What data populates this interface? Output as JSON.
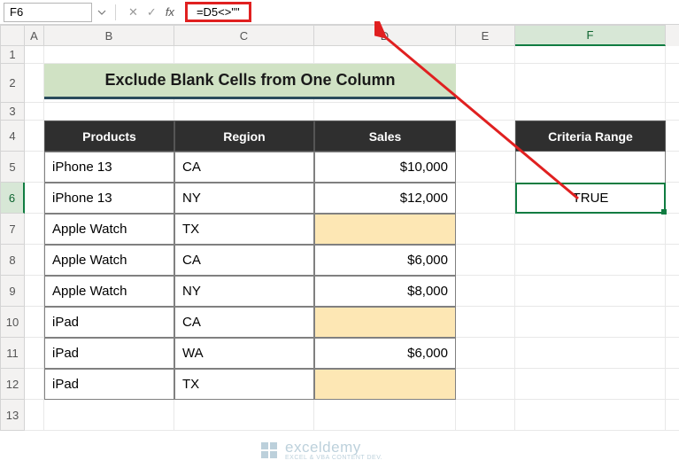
{
  "formula_bar": {
    "name_box": "F6",
    "formula": "=D5<>\"\""
  },
  "columns": [
    "A",
    "B",
    "C",
    "D",
    "E",
    "F"
  ],
  "rows": [
    "1",
    "2",
    "3",
    "4",
    "5",
    "6",
    "7",
    "8",
    "9",
    "10",
    "11",
    "12",
    "13"
  ],
  "active_cell": "F6",
  "title": "Exclude Blank Cells from One Column",
  "headers": {
    "c1": "Products",
    "c2": "Region",
    "c3": "Sales"
  },
  "data": [
    {
      "product": "iPhone 13",
      "region": "CA",
      "sales": "$10,000"
    },
    {
      "product": "iPhone 13",
      "region": "NY",
      "sales": "$12,000"
    },
    {
      "product": "Apple Watch",
      "region": "TX",
      "sales": ""
    },
    {
      "product": "Apple Watch",
      "region": "CA",
      "sales": "$6,000"
    },
    {
      "product": "Apple Watch",
      "region": "NY",
      "sales": "$8,000"
    },
    {
      "product": "iPad",
      "region": "CA",
      "sales": ""
    },
    {
      "product": "iPad",
      "region": "WA",
      "sales": "$6,000"
    },
    {
      "product": "iPad",
      "region": "TX",
      "sales": ""
    }
  ],
  "criteria": {
    "header": "Criteria Range",
    "value": "TRUE"
  },
  "watermark": {
    "brand": "exceldemy",
    "tag": "EXCEL & VBA CONTENT DEV."
  }
}
